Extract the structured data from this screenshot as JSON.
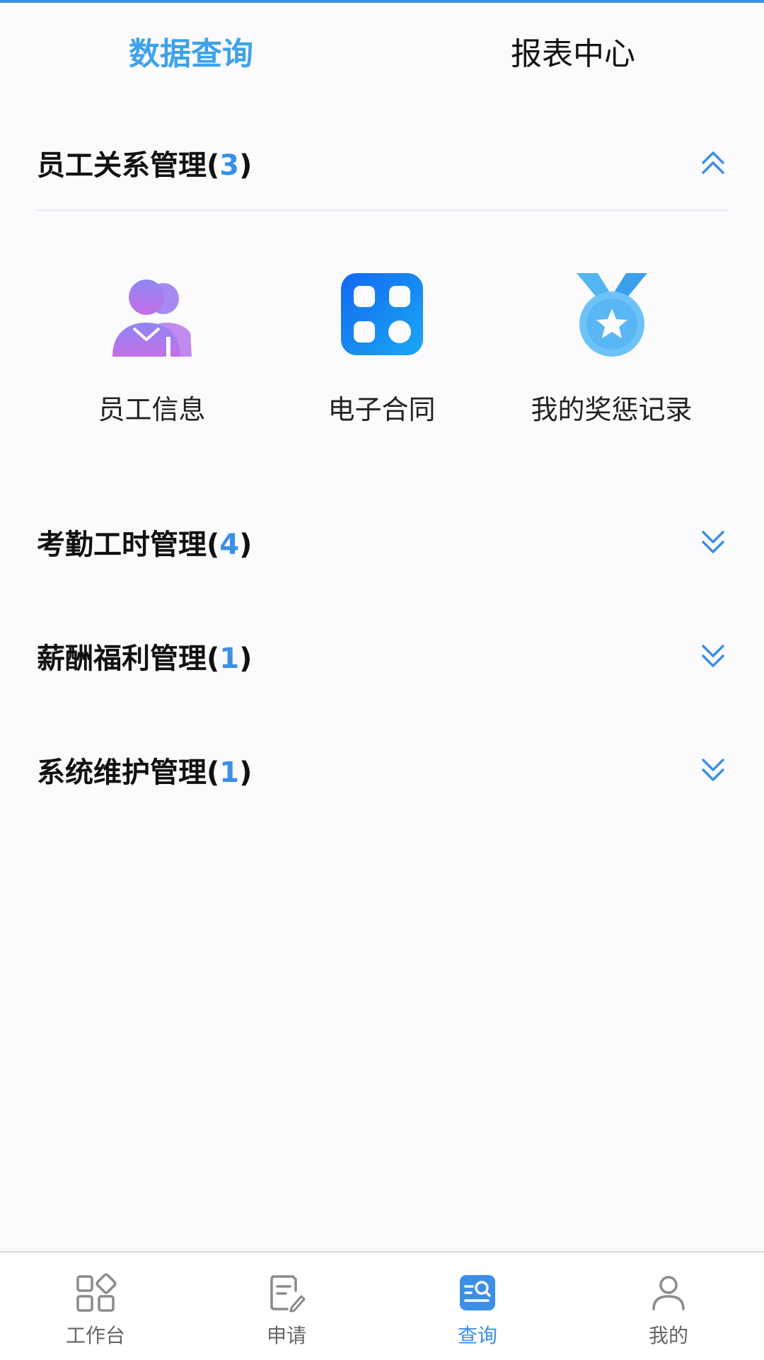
{
  "tabs": {
    "data_query": "数据查询",
    "report_center": "报表中心"
  },
  "sections": [
    {
      "title": "员工关系管理",
      "count": "3",
      "expanded": true
    },
    {
      "title": "考勤工时管理",
      "count": "4",
      "expanded": false
    },
    {
      "title": "薪酬福利管理",
      "count": "1",
      "expanded": false
    },
    {
      "title": "系统维护管理",
      "count": "1",
      "expanded": false
    }
  ],
  "employee_items": [
    {
      "label": "员工信息",
      "icon": "users-icon"
    },
    {
      "label": "电子合同",
      "icon": "grid-apps-icon"
    },
    {
      "label": "我的奖惩记录",
      "icon": "medal-icon"
    }
  ],
  "nav": [
    {
      "label": "工作台",
      "icon": "workbench-icon"
    },
    {
      "label": "申请",
      "icon": "apply-icon"
    },
    {
      "label": "查询",
      "icon": "query-icon",
      "active": true
    },
    {
      "label": "我的",
      "icon": "profile-icon"
    }
  ],
  "colors": {
    "accent": "#3b8fe6",
    "tab_active": "#3ea2e8",
    "users_icon": "#a06ef0",
    "grid_icon": "#1a7ff0",
    "medal_icon": "#5ab7f5"
  }
}
